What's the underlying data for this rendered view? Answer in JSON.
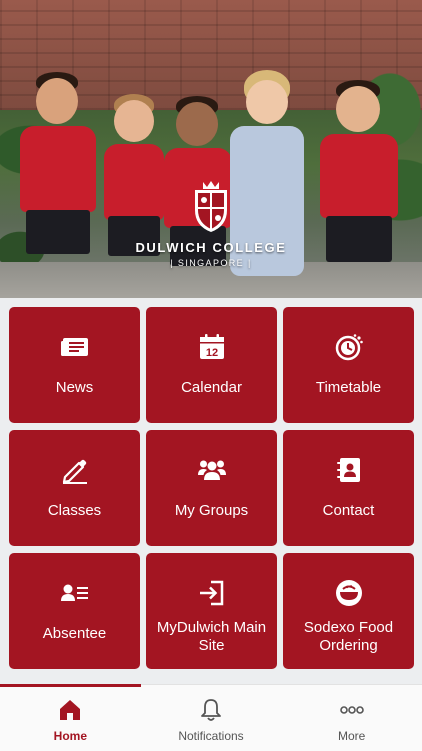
{
  "hero": {
    "school_name": "DULWICH COLLEGE",
    "school_location": "| SINGAPORE |"
  },
  "tiles": [
    {
      "label": "News",
      "icon": "newspaper-icon"
    },
    {
      "label": "Calendar",
      "icon": "calendar-icon",
      "icon_text": "12"
    },
    {
      "label": "Timetable",
      "icon": "timetable-clock-icon"
    },
    {
      "label": "Classes",
      "icon": "pencil-icon"
    },
    {
      "label": "My Groups",
      "icon": "group-icon"
    },
    {
      "label": "Contact",
      "icon": "contact-book-icon"
    },
    {
      "label": "Absentee",
      "icon": "absentee-list-icon"
    },
    {
      "label": "MyDulwich Main Site",
      "icon": "sign-in-icon"
    },
    {
      "label": "Sodexo Food Ordering",
      "icon": "food-bowl-icon"
    }
  ],
  "bottom_nav": [
    {
      "label": "Home",
      "icon": "home-icon",
      "active": true
    },
    {
      "label": "Notifications",
      "icon": "bell-icon",
      "active": false
    },
    {
      "label": "More",
      "icon": "more-dots-icon",
      "active": false
    }
  ],
  "colors": {
    "primary": "#a31522",
    "background": "#eceef0",
    "nav_background": "#fafafa"
  }
}
